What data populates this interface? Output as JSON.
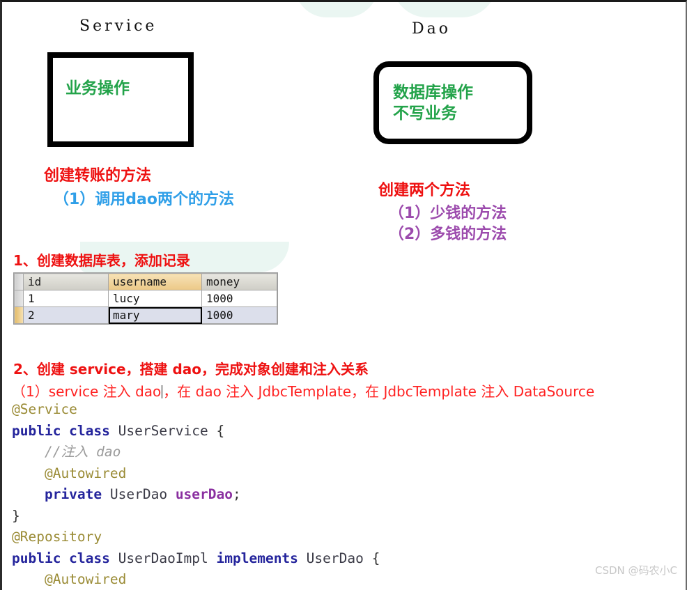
{
  "diagram": {
    "service": {
      "title": "Service",
      "box_text": "业务操作",
      "box_color": "#23a34a",
      "annotation_head": "创建转账的方法",
      "annotation_head_color": "#ee1111",
      "annotation_sub": "（1）调用dao两个的方法",
      "annotation_sub_color": "#2f9fe8"
    },
    "dao": {
      "title": "Dao",
      "box_text": "数据库操作\n不写业务",
      "box_color": "#23a34a",
      "annotation_head": "创建两个方法",
      "annotation_head_color": "#ee1111",
      "annotation_sub1": "（1）少钱的方法",
      "annotation_sub2": "（2）多钱的方法",
      "annotation_sub_color": "#9c4bad"
    }
  },
  "sections": {
    "step1_heading": "1、创建数据库表，添加记录",
    "step2_heading": "2、创建 service，搭建 dao，完成对象创建和注入关系",
    "step2_sub_before_caret": "（1）service 注入 dao",
    "step2_sub_after_caret": "，在 dao 注入 JdbcTemplate，在 JdbcTemplate 注入 DataSource",
    "heading_color": "#ee1111"
  },
  "table": {
    "columns": [
      "id",
      "username",
      "money"
    ],
    "highlighted_column": "username",
    "rows": [
      {
        "id": "1",
        "username": "lucy",
        "money": "1000",
        "selected": false
      },
      {
        "id": "2",
        "username": "mary",
        "money": "1000",
        "selected": true
      }
    ],
    "focused_cell": "mary",
    "header_bg": "#cfcec6",
    "header_highlight_bg": "#ecc887",
    "selected_row_bg": "#dcdfeb",
    "row_marker_selected_bg": "#e3bb6a"
  },
  "code": {
    "lines": [
      {
        "tokens": [
          {
            "t": "@Service",
            "c": "tk-anno"
          }
        ]
      },
      {
        "tokens": [
          {
            "t": "public class ",
            "c": "tk-kw"
          },
          {
            "t": "UserService ",
            "c": "tk-type"
          },
          {
            "t": "{",
            "c": "tk-punc"
          }
        ]
      },
      {
        "tokens": [
          {
            "t": "    //注入 dao",
            "c": "tk-comment"
          }
        ]
      },
      {
        "tokens": [
          {
            "t": "    @Autowired",
            "c": "tk-anno"
          }
        ]
      },
      {
        "tokens": [
          {
            "t": "    private ",
            "c": "tk-kw"
          },
          {
            "t": "UserDao ",
            "c": "tk-type"
          },
          {
            "t": "userDao",
            "c": "tk-field"
          },
          {
            "t": ";",
            "c": "tk-punc"
          }
        ]
      },
      {
        "tokens": [
          {
            "t": "}",
            "c": "tk-punc"
          }
        ]
      },
      {
        "tokens": [
          {
            "t": "@Repository",
            "c": "tk-anno"
          }
        ]
      },
      {
        "tokens": [
          {
            "t": "public class ",
            "c": "tk-kw"
          },
          {
            "t": "UserDaoImpl ",
            "c": "tk-type"
          },
          {
            "t": "implements ",
            "c": "tk-kw"
          },
          {
            "t": "UserDao ",
            "c": "tk-type"
          },
          {
            "t": "{",
            "c": "tk-punc"
          }
        ]
      },
      {
        "tokens": [
          {
            "t": "    @Autowired",
            "c": "tk-anno"
          }
        ]
      }
    ]
  },
  "watermark": {
    "text": "CSDN @码农小C"
  }
}
